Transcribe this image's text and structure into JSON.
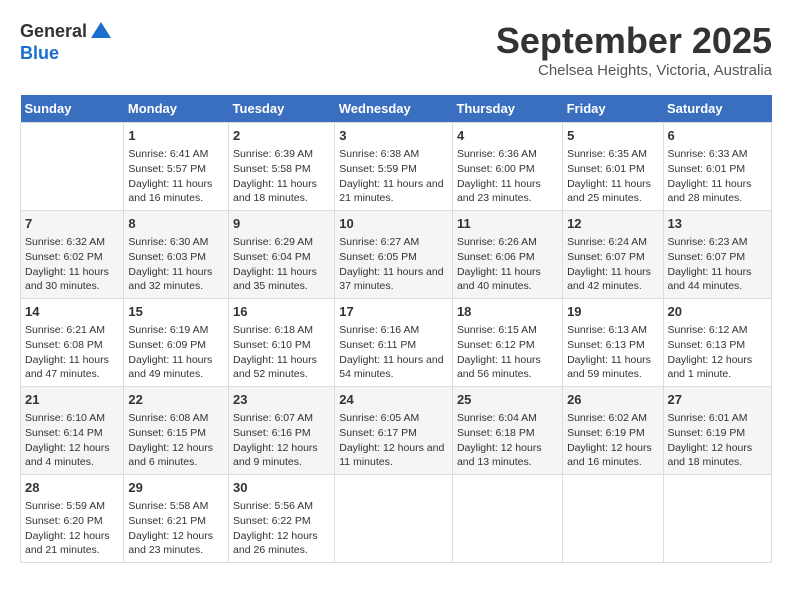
{
  "logo": {
    "general": "General",
    "blue": "Blue"
  },
  "title": "September 2025",
  "location": "Chelsea Heights, Victoria, Australia",
  "days_header": [
    "Sunday",
    "Monday",
    "Tuesday",
    "Wednesday",
    "Thursday",
    "Friday",
    "Saturday"
  ],
  "weeks": [
    [
      {
        "day": "",
        "sunrise": "",
        "sunset": "",
        "daylight": ""
      },
      {
        "day": "1",
        "sunrise": "Sunrise: 6:41 AM",
        "sunset": "Sunset: 5:57 PM",
        "daylight": "Daylight: 11 hours and 16 minutes."
      },
      {
        "day": "2",
        "sunrise": "Sunrise: 6:39 AM",
        "sunset": "Sunset: 5:58 PM",
        "daylight": "Daylight: 11 hours and 18 minutes."
      },
      {
        "day": "3",
        "sunrise": "Sunrise: 6:38 AM",
        "sunset": "Sunset: 5:59 PM",
        "daylight": "Daylight: 11 hours and 21 minutes."
      },
      {
        "day": "4",
        "sunrise": "Sunrise: 6:36 AM",
        "sunset": "Sunset: 6:00 PM",
        "daylight": "Daylight: 11 hours and 23 minutes."
      },
      {
        "day": "5",
        "sunrise": "Sunrise: 6:35 AM",
        "sunset": "Sunset: 6:01 PM",
        "daylight": "Daylight: 11 hours and 25 minutes."
      },
      {
        "day": "6",
        "sunrise": "Sunrise: 6:33 AM",
        "sunset": "Sunset: 6:01 PM",
        "daylight": "Daylight: 11 hours and 28 minutes."
      }
    ],
    [
      {
        "day": "7",
        "sunrise": "Sunrise: 6:32 AM",
        "sunset": "Sunset: 6:02 PM",
        "daylight": "Daylight: 11 hours and 30 minutes."
      },
      {
        "day": "8",
        "sunrise": "Sunrise: 6:30 AM",
        "sunset": "Sunset: 6:03 PM",
        "daylight": "Daylight: 11 hours and 32 minutes."
      },
      {
        "day": "9",
        "sunrise": "Sunrise: 6:29 AM",
        "sunset": "Sunset: 6:04 PM",
        "daylight": "Daylight: 11 hours and 35 minutes."
      },
      {
        "day": "10",
        "sunrise": "Sunrise: 6:27 AM",
        "sunset": "Sunset: 6:05 PM",
        "daylight": "Daylight: 11 hours and 37 minutes."
      },
      {
        "day": "11",
        "sunrise": "Sunrise: 6:26 AM",
        "sunset": "Sunset: 6:06 PM",
        "daylight": "Daylight: 11 hours and 40 minutes."
      },
      {
        "day": "12",
        "sunrise": "Sunrise: 6:24 AM",
        "sunset": "Sunset: 6:07 PM",
        "daylight": "Daylight: 11 hours and 42 minutes."
      },
      {
        "day": "13",
        "sunrise": "Sunrise: 6:23 AM",
        "sunset": "Sunset: 6:07 PM",
        "daylight": "Daylight: 11 hours and 44 minutes."
      }
    ],
    [
      {
        "day": "14",
        "sunrise": "Sunrise: 6:21 AM",
        "sunset": "Sunset: 6:08 PM",
        "daylight": "Daylight: 11 hours and 47 minutes."
      },
      {
        "day": "15",
        "sunrise": "Sunrise: 6:19 AM",
        "sunset": "Sunset: 6:09 PM",
        "daylight": "Daylight: 11 hours and 49 minutes."
      },
      {
        "day": "16",
        "sunrise": "Sunrise: 6:18 AM",
        "sunset": "Sunset: 6:10 PM",
        "daylight": "Daylight: 11 hours and 52 minutes."
      },
      {
        "day": "17",
        "sunrise": "Sunrise: 6:16 AM",
        "sunset": "Sunset: 6:11 PM",
        "daylight": "Daylight: 11 hours and 54 minutes."
      },
      {
        "day": "18",
        "sunrise": "Sunrise: 6:15 AM",
        "sunset": "Sunset: 6:12 PM",
        "daylight": "Daylight: 11 hours and 56 minutes."
      },
      {
        "day": "19",
        "sunrise": "Sunrise: 6:13 AM",
        "sunset": "Sunset: 6:13 PM",
        "daylight": "Daylight: 11 hours and 59 minutes."
      },
      {
        "day": "20",
        "sunrise": "Sunrise: 6:12 AM",
        "sunset": "Sunset: 6:13 PM",
        "daylight": "Daylight: 12 hours and 1 minute."
      }
    ],
    [
      {
        "day": "21",
        "sunrise": "Sunrise: 6:10 AM",
        "sunset": "Sunset: 6:14 PM",
        "daylight": "Daylight: 12 hours and 4 minutes."
      },
      {
        "day": "22",
        "sunrise": "Sunrise: 6:08 AM",
        "sunset": "Sunset: 6:15 PM",
        "daylight": "Daylight: 12 hours and 6 minutes."
      },
      {
        "day": "23",
        "sunrise": "Sunrise: 6:07 AM",
        "sunset": "Sunset: 6:16 PM",
        "daylight": "Daylight: 12 hours and 9 minutes."
      },
      {
        "day": "24",
        "sunrise": "Sunrise: 6:05 AM",
        "sunset": "Sunset: 6:17 PM",
        "daylight": "Daylight: 12 hours and 11 minutes."
      },
      {
        "day": "25",
        "sunrise": "Sunrise: 6:04 AM",
        "sunset": "Sunset: 6:18 PM",
        "daylight": "Daylight: 12 hours and 13 minutes."
      },
      {
        "day": "26",
        "sunrise": "Sunrise: 6:02 AM",
        "sunset": "Sunset: 6:19 PM",
        "daylight": "Daylight: 12 hours and 16 minutes."
      },
      {
        "day": "27",
        "sunrise": "Sunrise: 6:01 AM",
        "sunset": "Sunset: 6:19 PM",
        "daylight": "Daylight: 12 hours and 18 minutes."
      }
    ],
    [
      {
        "day": "28",
        "sunrise": "Sunrise: 5:59 AM",
        "sunset": "Sunset: 6:20 PM",
        "daylight": "Daylight: 12 hours and 21 minutes."
      },
      {
        "day": "29",
        "sunrise": "Sunrise: 5:58 AM",
        "sunset": "Sunset: 6:21 PM",
        "daylight": "Daylight: 12 hours and 23 minutes."
      },
      {
        "day": "30",
        "sunrise": "Sunrise: 5:56 AM",
        "sunset": "Sunset: 6:22 PM",
        "daylight": "Daylight: 12 hours and 26 minutes."
      },
      {
        "day": "",
        "sunrise": "",
        "sunset": "",
        "daylight": ""
      },
      {
        "day": "",
        "sunrise": "",
        "sunset": "",
        "daylight": ""
      },
      {
        "day": "",
        "sunrise": "",
        "sunset": "",
        "daylight": ""
      },
      {
        "day": "",
        "sunrise": "",
        "sunset": "",
        "daylight": ""
      }
    ]
  ]
}
